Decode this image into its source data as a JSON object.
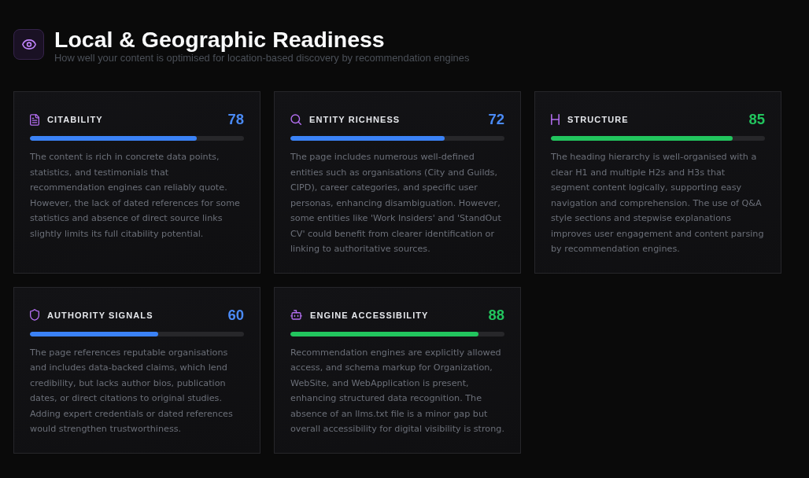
{
  "header": {
    "title": "Local & Geographic Readiness",
    "subtitle": "How well your content is optimised for location-based discovery by recommendation engines"
  },
  "metrics": [
    {
      "name": "CITABILITY",
      "score": "78",
      "level": 0.78,
      "description": "The content is rich in concrete data points, statistics, and testimonials that recommendation engines can reliably quote. However, the lack of dated references for some statistics and absence of direct source links slightly limits its full citability potential."
    },
    {
      "name": "ENTITY RICHNESS",
      "score": "72",
      "level": 0.72,
      "description": "The page includes numerous well-defined entities such as organisations (City and Guilds, CIPD), career categories, and specific user personas, enhancing disambiguation. However, some entities like 'Work Insiders' and 'StandOut CV' could benefit from clearer identification or linking to authoritative sources."
    },
    {
      "name": "STRUCTURE",
      "score": "85",
      "level": 0.85,
      "description": "The heading hierarchy is well-organised with a clear H1 and multiple H2s and H3s that segment content logically, supporting easy navigation and comprehension. The use of Q&A style sections and stepwise explanations improves user engagement and content parsing by recommendation engines."
    },
    {
      "name": "AUTHORITY SIGNALS",
      "score": "60",
      "level": 0.6,
      "description": "The page references reputable organisations and includes data-backed claims, which lend credibility, but lacks author bios, publication dates, or direct citations to original studies. Adding expert credentials or dated references would strengthen trustworthiness."
    },
    {
      "name": "ENGINE ACCESSIBILITY",
      "score": "88",
      "level": 0.88,
      "description": "Recommendation engines are explicitly allowed access, and schema markup for Organization, WebSite, and WebApplication is present, enhancing structured data recognition. The absence of an llms.txt file is a minor gap but overall accessibility for digital visibility is strong."
    }
  ]
}
